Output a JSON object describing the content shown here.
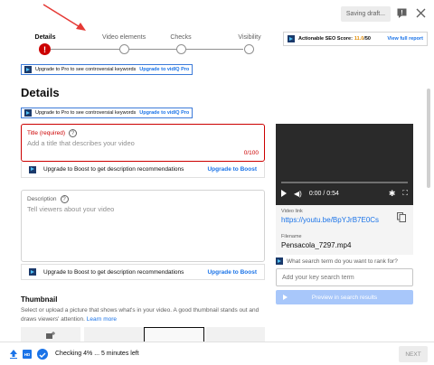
{
  "header": {
    "saving_label": "Saving draft...",
    "feedback_icon": "feedback-icon",
    "close_icon": "close-icon"
  },
  "stepper": {
    "steps": [
      {
        "label": "Details",
        "state": "error"
      },
      {
        "label": "Video elements",
        "state": "pending"
      },
      {
        "label": "Checks",
        "state": "pending"
      },
      {
        "label": "Visibility",
        "state": "pending"
      }
    ]
  },
  "seo": {
    "prefix": "Actionable SEO Score:",
    "score": "11.0",
    "suffix": "/50",
    "link": "View full report"
  },
  "vidiq_banner": {
    "text": "Upgrade to Pro to see controversial keywords",
    "link": "Upgrade to vidIQ Pro"
  },
  "section_title": "Details",
  "title_field": {
    "label": "Title (required)",
    "placeholder": "Add a title that describes your video",
    "counter": "0/100"
  },
  "boost_banner": {
    "text": "Upgrade to Boost to get description recommendations",
    "link": "Upgrade to Boost"
  },
  "description_field": {
    "label": "Description",
    "placeholder": "Tell viewers about your video"
  },
  "thumbnail": {
    "title": "Thumbnail",
    "text": "Select or upload a picture that shows what's in your video. A good thumbnail stands out and draws viewers' attention.",
    "link": "Learn more"
  },
  "video": {
    "time": "0:00 / 0:54",
    "link_label": "Video link",
    "link": "https://youtu.be/BpYJrB7E0Cs",
    "filename_label": "Filename",
    "filename": "Pensacola_7297.mp4"
  },
  "keyword": {
    "question": "What search term do you want to rank for?",
    "placeholder": "Add your key search term",
    "preview_button": "Preview in search results"
  },
  "footer": {
    "hd_badge": "HD",
    "status": "Checking 4% ... 5 minutes left",
    "next_button": "NEXT"
  },
  "colors": {
    "accent": "#1a73e8",
    "error": "#cc0000",
    "annotation_arrow": "#e53935"
  }
}
